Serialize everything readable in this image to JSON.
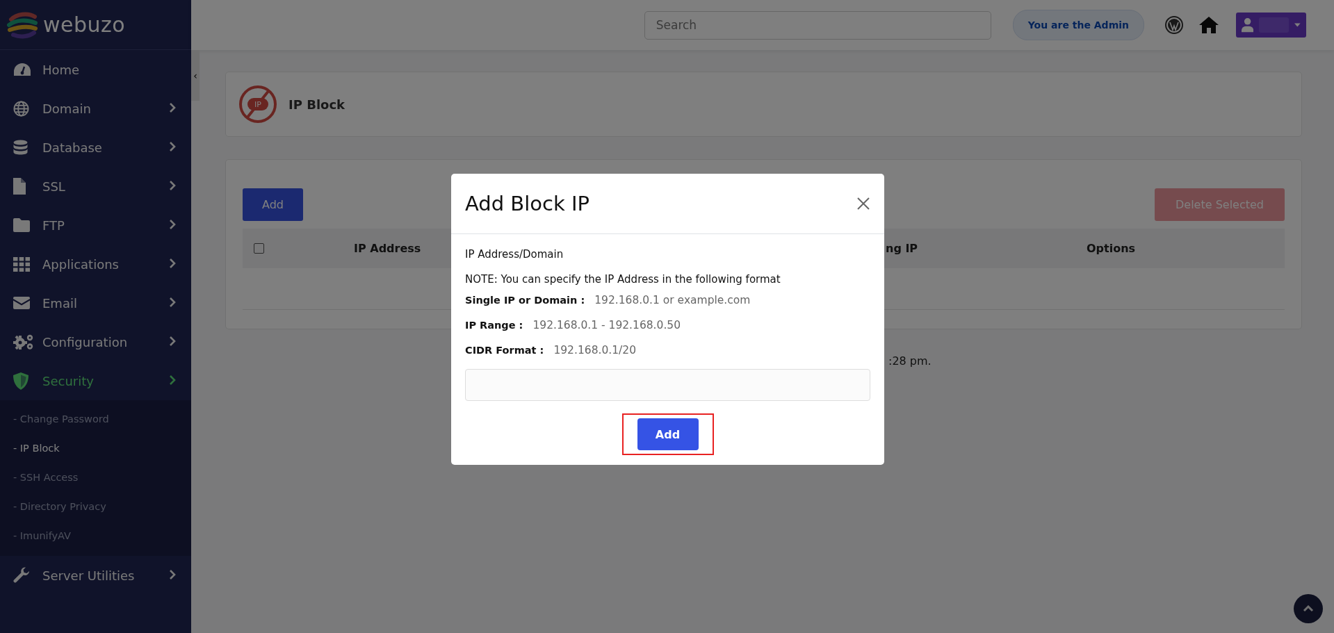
{
  "sidebar": {
    "logo": "webuzo",
    "collapse_glyph": "‹",
    "items": [
      {
        "label": "Home",
        "expandable": false,
        "selected": false
      },
      {
        "label": "Domain",
        "expandable": true,
        "selected": false
      },
      {
        "label": "Database",
        "expandable": true,
        "selected": false
      },
      {
        "label": "SSL",
        "expandable": true,
        "selected": false
      },
      {
        "label": "FTP",
        "expandable": true,
        "selected": false
      },
      {
        "label": "Applications",
        "expandable": true,
        "selected": false
      },
      {
        "label": "Email",
        "expandable": true,
        "selected": false
      },
      {
        "label": "Configuration",
        "expandable": true,
        "selected": false
      },
      {
        "label": "Security",
        "expandable": true,
        "selected": true,
        "expanded": true,
        "children": [
          {
            "label": "- Change Password",
            "selected": false
          },
          {
            "label": "- IP Block",
            "selected": true
          },
          {
            "label": "- SSH Access",
            "selected": false
          },
          {
            "label": "- Directory Privacy",
            "selected": false
          },
          {
            "label": "- ImunifyAV",
            "selected": false
          }
        ]
      },
      {
        "label": "Server Utilities",
        "expandable": true,
        "selected": false
      }
    ]
  },
  "topbar": {
    "search": {
      "placeholder": "Search"
    },
    "admin_badge": "You are the Admin"
  },
  "page_header": {
    "icon_text": "IP",
    "title": "IP Block"
  },
  "panel": {
    "add_button": "Add",
    "delete_button": {
      "label": "Delete Selected",
      "disabled": true
    },
    "select_all": {
      "checked": false
    },
    "columns": [
      "IP Address",
      "ng IP",
      "Options"
    ],
    "footer_text": ":28 pm."
  },
  "modal": {
    "title": "Add Block IP",
    "field_label": "IP Address/Domain",
    "note": "NOTE: You can specify the IP Address in the following format",
    "formats": [
      {
        "label": "Single IP or Domain :",
        "example": "192.168.0.1 or example.com"
      },
      {
        "label": "IP Range :",
        "example": "192.168.0.1 - 192.168.0.50"
      },
      {
        "label": "CIDR Format :",
        "example": "192.168.0.1/20"
      }
    ],
    "submit": {
      "label": "Add",
      "highlighted": true
    }
  }
}
